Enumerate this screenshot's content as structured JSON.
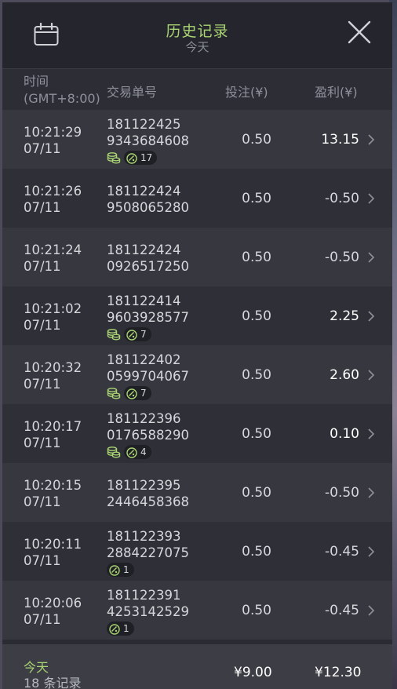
{
  "header": {
    "title": "历史记录",
    "subtitle": "今天",
    "calendar_icon": "calendar-icon",
    "close_icon": "close-icon"
  },
  "columns": {
    "time_line1": "时间",
    "time_line2": "(GMT+8:00)",
    "order_id": "交易单号",
    "bet": "投注(¥)",
    "profit": "盈利(¥)"
  },
  "rows": [
    {
      "time": "10:21:29",
      "date": "07/11",
      "id1": "181122425",
      "id2": "9343684608",
      "bet": "0.50",
      "profit": "13.15",
      "coin": true,
      "ball": "17"
    },
    {
      "time": "10:21:26",
      "date": "07/11",
      "id1": "181122424",
      "id2": "9508065280",
      "bet": "0.50",
      "profit": "-0.50"
    },
    {
      "time": "10:21:24",
      "date": "07/11",
      "id1": "181122424",
      "id2": "0926517250",
      "bet": "0.50",
      "profit": "-0.50"
    },
    {
      "time": "10:21:02",
      "date": "07/11",
      "id1": "181122414",
      "id2": "9603928577",
      "bet": "0.50",
      "profit": "2.25",
      "coin": true,
      "ball": "7"
    },
    {
      "time": "10:20:32",
      "date": "07/11",
      "id1": "181122402",
      "id2": "0599704067",
      "bet": "0.50",
      "profit": "2.60",
      "coin": true,
      "ball": "7"
    },
    {
      "time": "10:20:17",
      "date": "07/11",
      "id1": "181122396",
      "id2": "0176588290",
      "bet": "0.50",
      "profit": "0.10",
      "coin": true,
      "ball": "4"
    },
    {
      "time": "10:20:15",
      "date": "07/11",
      "id1": "181122395",
      "id2": "2446458368",
      "bet": "0.50",
      "profit": "-0.50"
    },
    {
      "time": "10:20:11",
      "date": "07/11",
      "id1": "181122393",
      "id2": "2884227075",
      "bet": "0.50",
      "profit": "-0.45",
      "ball": "1"
    },
    {
      "time": "10:20:06",
      "date": "07/11",
      "id1": "181122391",
      "id2": "4253142529",
      "bet": "0.50",
      "profit": "-0.45",
      "ball": "1"
    }
  ],
  "footer": {
    "today": "今天",
    "count": "18 条记录",
    "total_bet": "¥9.00",
    "total_profit": "¥12.30"
  },
  "colors": {
    "accent_green": "#a9d472",
    "panel_bg": "#2a2b33",
    "row_odd": "#37383f",
    "row_even": "#2f3037"
  }
}
